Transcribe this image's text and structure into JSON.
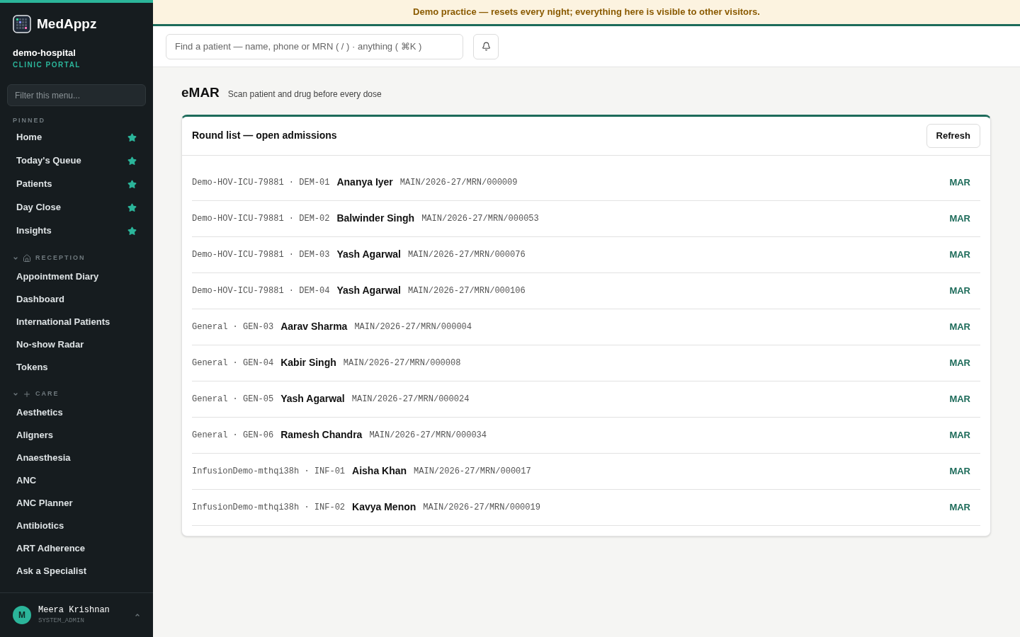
{
  "sidebar": {
    "brand": "MedAppz",
    "org": "demo-hospital",
    "portal": "CLINIC PORTAL",
    "filter": {
      "placeholder": "Filter this menu..."
    },
    "pinned": {
      "title": "PINNED",
      "items": [
        "Home",
        "Today's Queue",
        "Patients",
        "Day Close",
        "Insights"
      ]
    },
    "sections": [
      {
        "title": "RECEPTION",
        "expanded": true,
        "items": [
          "Appointment Diary",
          "Dashboard",
          "International Patients",
          "No-show Radar",
          "Tokens"
        ]
      },
      {
        "title": "CARE",
        "expanded": true,
        "items": [
          "Aesthetics",
          "Aligners",
          "Anaesthesia",
          "ANC",
          "ANC Planner",
          "Antibiotics",
          "ART Adherence",
          "Ask a Specialist"
        ]
      }
    ],
    "user": {
      "initial": "M",
      "name": "Meera Krishnan",
      "role": "SYSTEM_ADMIN"
    }
  },
  "banner": "Demo practice — resets every night; everything here is visible to other visitors.",
  "search": {
    "placeholder": "Find a patient — name, phone or MRN ( / ) · anything ( ⌘K )"
  },
  "page": {
    "title": "eMAR",
    "subtitle": "Scan patient and drug before every dose"
  },
  "card": {
    "title": "Round list — open admissions",
    "button": "Refresh",
    "rows": [
      {
        "location": "Demo-HOV-ICU-79881 · DEM-01",
        "name": "Ananya Iyer",
        "mrn": "MAIN/2026-27/MRN/000009",
        "action": "MAR"
      },
      {
        "location": "Demo-HOV-ICU-79881 · DEM-02",
        "name": "Balwinder Singh",
        "mrn": "MAIN/2026-27/MRN/000053",
        "action": "MAR"
      },
      {
        "location": "Demo-HOV-ICU-79881 · DEM-03",
        "name": "Yash Agarwal",
        "mrn": "MAIN/2026-27/MRN/000076",
        "action": "MAR"
      },
      {
        "location": "Demo-HOV-ICU-79881 · DEM-04",
        "name": "Yash Agarwal",
        "mrn": "MAIN/2026-27/MRN/000106",
        "action": "MAR"
      },
      {
        "location": "General · GEN-03",
        "name": "Aarav Sharma",
        "mrn": "MAIN/2026-27/MRN/000004",
        "action": "MAR"
      },
      {
        "location": "General · GEN-04",
        "name": "Kabir Singh",
        "mrn": "MAIN/2026-27/MRN/000008",
        "action": "MAR"
      },
      {
        "location": "General · GEN-05",
        "name": "Yash Agarwal",
        "mrn": "MAIN/2026-27/MRN/000024",
        "action": "MAR"
      },
      {
        "location": "General · GEN-06",
        "name": "Ramesh Chandra",
        "mrn": "MAIN/2026-27/MRN/000034",
        "action": "MAR"
      },
      {
        "location": "InfusionDemo-mthqi38h · INF-01",
        "name": "Aisha Khan",
        "mrn": "MAIN/2026-27/MRN/000017",
        "action": "MAR"
      },
      {
        "location": "InfusionDemo-mthqi38h · INF-02",
        "name": "Kavya Menon",
        "mrn": "MAIN/2026-27/MRN/000019",
        "action": "MAR"
      }
    ]
  }
}
